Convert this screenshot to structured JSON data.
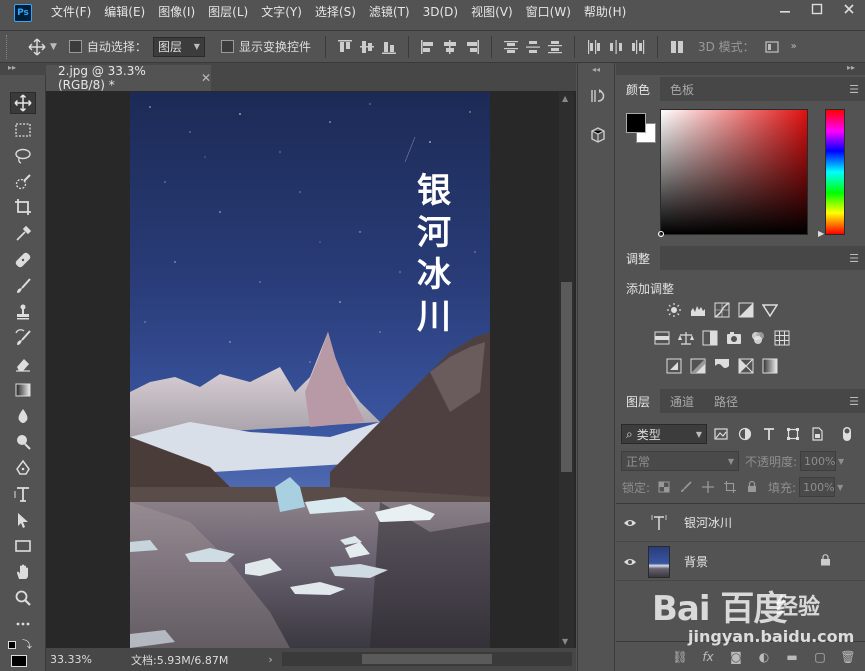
{
  "app": {
    "logo": "Ps",
    "menu": [
      "文件(F)",
      "编辑(E)",
      "图像(I)",
      "图层(L)",
      "文字(Y)",
      "选择(S)",
      "滤镜(T)",
      "3D(D)",
      "视图(V)",
      "窗口(W)",
      "帮助(H)"
    ],
    "window_controls": [
      "minimize-icon",
      "maximize-icon",
      "close-icon"
    ]
  },
  "options": {
    "auto_select_label": "自动选择：",
    "auto_select_target": "图层",
    "show_transform_label": "显示变换控件",
    "mode_3d_label": "3D 模式："
  },
  "document": {
    "tab_title": "2.jpg @ 33.3%(RGB/8) *",
    "canvas_text": [
      "银",
      "河",
      "冰",
      "川"
    ],
    "zoom": "33.33%",
    "doc_size": "文档:5.93M/6.87M"
  },
  "panels": {
    "color_tabs": [
      "颜色",
      "色板"
    ],
    "color": {
      "foreground": "#000000",
      "background": "#ffffff",
      "hue": "#e01010"
    },
    "adjust_tab": "调整",
    "adjust_title": "添加调整",
    "layers_tabs": [
      "图层",
      "通道",
      "路径"
    ],
    "kind_filter": "类型",
    "blend_mode": "正常",
    "opacity_label": "不透明度:",
    "opacity_value": "100%",
    "lock_label": "锁定:",
    "fill_label": "填充:",
    "fill_value": "100%",
    "layers": [
      {
        "name": "银河冰川",
        "kind": "text-layer"
      },
      {
        "name": "背景",
        "kind": "image-layer",
        "locked": true
      }
    ]
  },
  "watermark": {
    "logo": "Bai 百度",
    "brand": "经验",
    "url": "jingyan.baidu.com"
  }
}
